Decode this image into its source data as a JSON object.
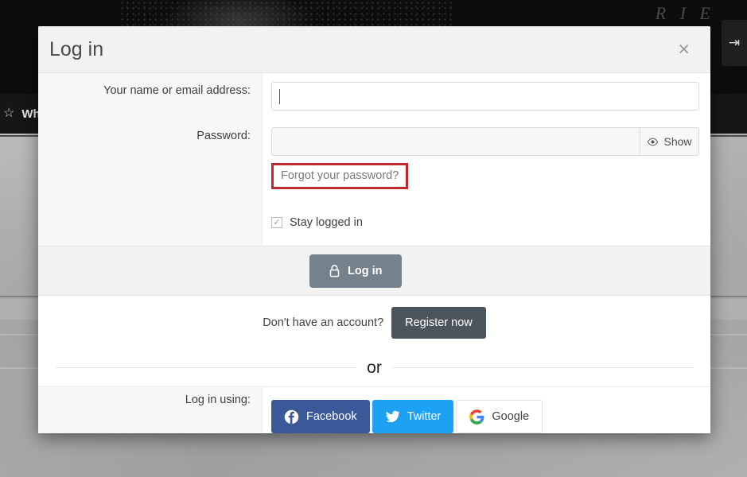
{
  "background": {
    "nav_star_icon": "star-outline-icon",
    "nav_label": "Wh",
    "corner_icon": "arrow-right-icon"
  },
  "dialog": {
    "title": "Log in",
    "close_label": "×",
    "fields": {
      "username": {
        "label": "Your name or email address:",
        "value": "",
        "placeholder": ""
      },
      "password": {
        "label": "Password:",
        "value": "",
        "placeholder": "",
        "show_label": "Show",
        "show_icon": "eye-icon"
      }
    },
    "forgot_password_link": "Forgot your password?",
    "stay_logged_in": {
      "label": "Stay logged in",
      "checked": true,
      "check_glyph": "✓"
    },
    "login_button": {
      "label": "Log in",
      "icon": "lock-icon"
    },
    "register": {
      "prompt": "Don't have an account?",
      "button_label": "Register now"
    },
    "divider_text": "or",
    "social": {
      "label": "Log in using:",
      "buttons": [
        {
          "label": "Facebook",
          "icon": "facebook-icon",
          "color": "#3b5998"
        },
        {
          "label": "Twitter",
          "icon": "twitter-icon",
          "color": "#1da1f2"
        },
        {
          "label": "Google",
          "icon": "google-icon",
          "color": "#ffffff"
        }
      ]
    }
  },
  "colors": {
    "highlight_box": "#c0282d",
    "login_button": "#75828c",
    "register_button": "#4d555c"
  }
}
